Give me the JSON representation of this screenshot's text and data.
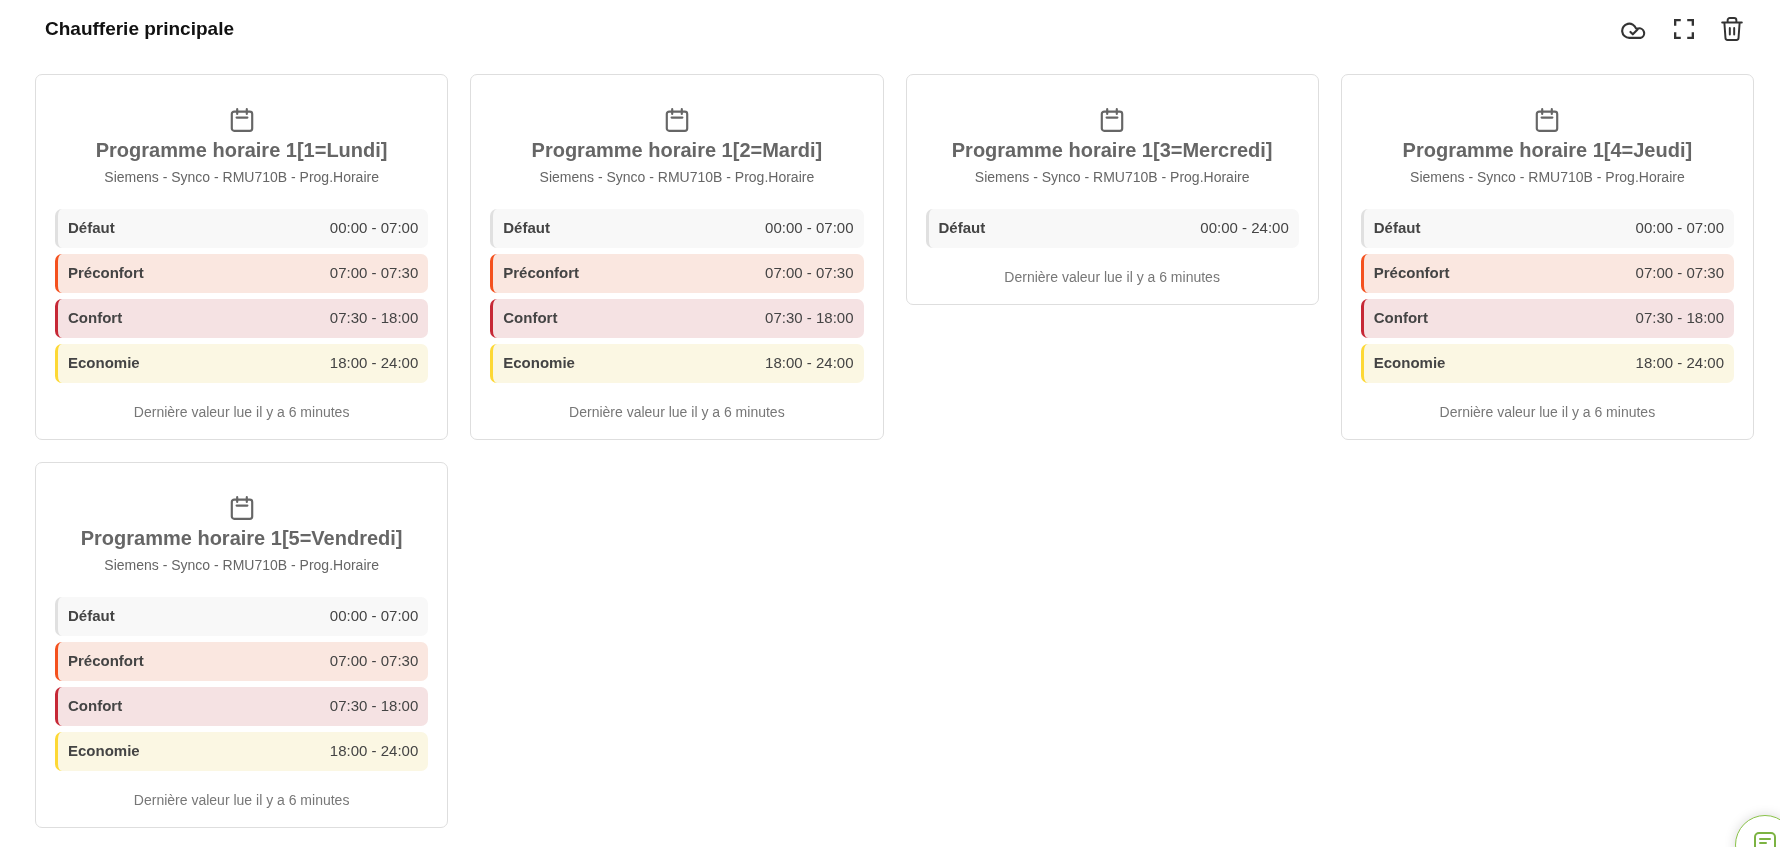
{
  "header": {
    "title": "Chaufferie principale"
  },
  "cards": [
    {
      "title": "Programme horaire 1[1=Lundi]",
      "subtitle": "Siemens - Synco - RMU710B - Prog.Horaire",
      "periods": [
        {
          "label": "Défaut",
          "range": "00:00 - 07:00",
          "color": "#e0e0e0"
        },
        {
          "label": "Préconfort",
          "range": "07:00 - 07:30",
          "color": "#f4511e"
        },
        {
          "label": "Confort",
          "range": "07:30 - 18:00",
          "color": "#c62836"
        },
        {
          "label": "Economie",
          "range": "18:00 - 24:00",
          "color": "#fdd835"
        }
      ],
      "footer": "Dernière valeur lue il y a 6 minutes"
    },
    {
      "title": "Programme horaire 1[2=Mardi]",
      "subtitle": "Siemens - Synco - RMU710B - Prog.Horaire",
      "periods": [
        {
          "label": "Défaut",
          "range": "00:00 - 07:00",
          "color": "#e0e0e0"
        },
        {
          "label": "Préconfort",
          "range": "07:00 - 07:30",
          "color": "#f4511e"
        },
        {
          "label": "Confort",
          "range": "07:30 - 18:00",
          "color": "#c62836"
        },
        {
          "label": "Economie",
          "range": "18:00 - 24:00",
          "color": "#fdd835"
        }
      ],
      "footer": "Dernière valeur lue il y a 6 minutes"
    },
    {
      "title": "Programme horaire 1[3=Mercredi]",
      "subtitle": "Siemens - Synco - RMU710B - Prog.Horaire",
      "periods": [
        {
          "label": "Défaut",
          "range": "00:00 - 24:00",
          "color": "#e0e0e0"
        }
      ],
      "footer": "Dernière valeur lue il y a 6 minutes"
    },
    {
      "title": "Programme horaire 1[4=Jeudi]",
      "subtitle": "Siemens - Synco - RMU710B - Prog.Horaire",
      "periods": [
        {
          "label": "Défaut",
          "range": "00:00 - 07:00",
          "color": "#e0e0e0"
        },
        {
          "label": "Préconfort",
          "range": "07:00 - 07:30",
          "color": "#f4511e"
        },
        {
          "label": "Confort",
          "range": "07:30 - 18:00",
          "color": "#c62836"
        },
        {
          "label": "Economie",
          "range": "18:00 - 24:00",
          "color": "#fdd835"
        }
      ],
      "footer": "Dernière valeur lue il y a 6 minutes"
    },
    {
      "title": "Programme horaire 1[5=Vendredi]",
      "subtitle": "Siemens - Synco - RMU710B - Prog.Horaire",
      "periods": [
        {
          "label": "Défaut",
          "range": "00:00 - 07:00",
          "color": "#e0e0e0"
        },
        {
          "label": "Préconfort",
          "range": "07:00 - 07:30",
          "color": "#f4511e"
        },
        {
          "label": "Confort",
          "range": "07:30 - 18:00",
          "color": "#c62836"
        },
        {
          "label": "Economie",
          "range": "18:00 - 24:00",
          "color": "#fdd835"
        }
      ],
      "footer": "Dernière valeur lue il y a 6 minutes"
    }
  ]
}
